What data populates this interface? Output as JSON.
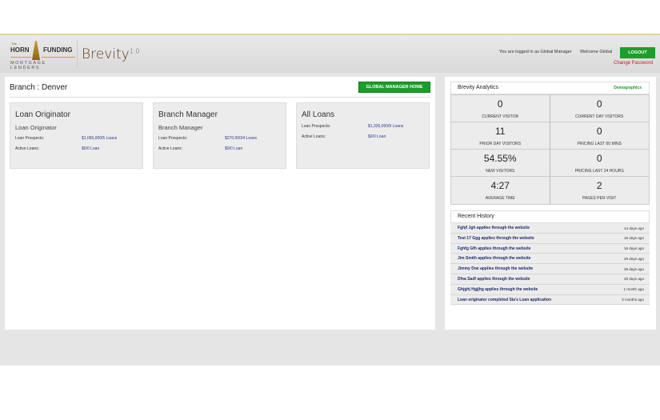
{
  "header": {
    "logo_text": "The HORN FUNDING Corp MORTGAGE LENDERS",
    "logo_the": "The",
    "logo_horn": "HORN",
    "logo_funding": "FUNDING",
    "logo_tagline": "MORTGAGE LENDERS",
    "app_name": "Brevity",
    "app_version": "1.0",
    "logged_in_text": "You are logged in as Global Manager",
    "welcome_text": "Welcome Global",
    "logout_label": "LOGOUT",
    "change_password": "Change Password"
  },
  "main": {
    "branch_title": "Branch : Denver",
    "gm_home_label": "GLOBAL MANAGER HOME",
    "cards": [
      {
        "title": "Loan Originator",
        "subtitle": "Loan Originator",
        "prospects_label": "Loan Prospects:",
        "prospects_value": "$1,065,000/5 Loans",
        "active_label": "Active Loans:",
        "active_value": "$0/0 Loan"
      },
      {
        "title": "Branch Manager",
        "subtitle": "Branch Manager",
        "prospects_label": "Loan Prospects:",
        "prospects_value": "$270,000/4 Loans",
        "active_label": "Active Loans:",
        "active_value": "$0/0 Loan"
      },
      {
        "title": "All Loans",
        "prospects_label": "Loan Prospects:",
        "prospects_value": "$1,335,000/9 Loans",
        "active_label": "Active Loans:",
        "active_value": "$0/0 Loan"
      }
    ]
  },
  "analytics": {
    "title": "Brevity Analytics",
    "demographics": "Demographics",
    "stats": [
      {
        "value": "0",
        "label": "CURRENT VISITOR"
      },
      {
        "value": "0",
        "label": "CURRENT DAY VISITORS"
      },
      {
        "value": "11",
        "label": "PRIOR DAY VISITORS"
      },
      {
        "value": "0",
        "label": "PRICING LAST 60 MINS"
      },
      {
        "value": "54.55%",
        "label": "NEW VISITORS"
      },
      {
        "value": "0",
        "label": "PRICING LAST 24 HOURS"
      },
      {
        "value": "4:27",
        "label": "AVERAGE TIME"
      },
      {
        "value": "2",
        "label": "PAGES PER VISIT"
      }
    ]
  },
  "history": {
    "title": "Recent History",
    "items": [
      {
        "text": "Fghjf Jgh applies through the website",
        "when": "14 days ago"
      },
      {
        "text": "Test 17 Ggg applies through the website",
        "when": "16 days ago"
      },
      {
        "text": "Fghfg Gfh applies through the website",
        "when": "16 days ago"
      },
      {
        "text": "Jim Smith applies through the website",
        "when": "29 days ago"
      },
      {
        "text": "Jimmy Doe applies through the website",
        "when": "29 days ago"
      },
      {
        "text": "Dfsa Sadf applies through the website",
        "when": "30 days ago"
      },
      {
        "text": "Ghjghj Hgjjhg applies through the website",
        "when": "1 month ago"
      },
      {
        "text": "Loan originator completed Sia's Loan application",
        "when": "3 months ago"
      }
    ]
  }
}
